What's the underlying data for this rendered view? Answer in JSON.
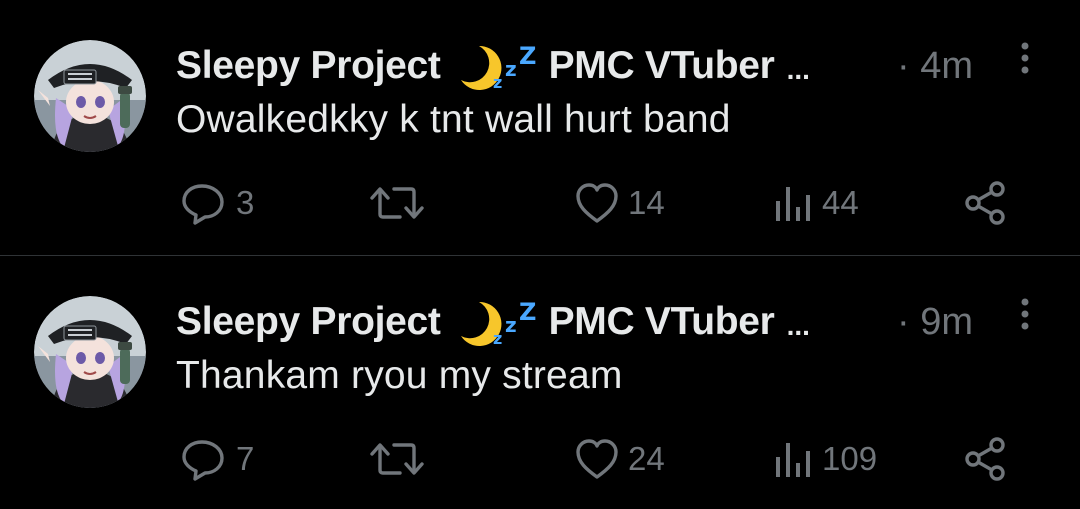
{
  "colors": {
    "background": "#000000",
    "text_primary": "#e7e9ea",
    "text_secondary": "#71767b",
    "divider": "#2f3336",
    "emoji_moon": "#f7c62b",
    "emoji_zzz": "#4aa8ff"
  },
  "posts": [
    {
      "author": {
        "display_name": "Sleepy Project",
        "display_name_suffix": "PMC VTuber",
        "truncation": "...",
        "emoji": "moon-zzz-emoji",
        "avatar": "avatar-image"
      },
      "time_separator": "·",
      "timestamp": "4m",
      "text": "Owalkedkky k tnt wall hurt band",
      "actions": {
        "replies": "3",
        "reposts": "",
        "likes": "14",
        "views": "44"
      }
    },
    {
      "author": {
        "display_name": "Sleepy Project",
        "display_name_suffix": "PMC VTuber",
        "truncation": "...",
        "emoji": "moon-zzz-emoji",
        "avatar": "avatar-image"
      },
      "time_separator": "·",
      "timestamp": "9m",
      "text": "Thankam ryou my stream",
      "actions": {
        "replies": "7",
        "reposts": "",
        "likes": "24",
        "views": "109"
      }
    }
  ]
}
